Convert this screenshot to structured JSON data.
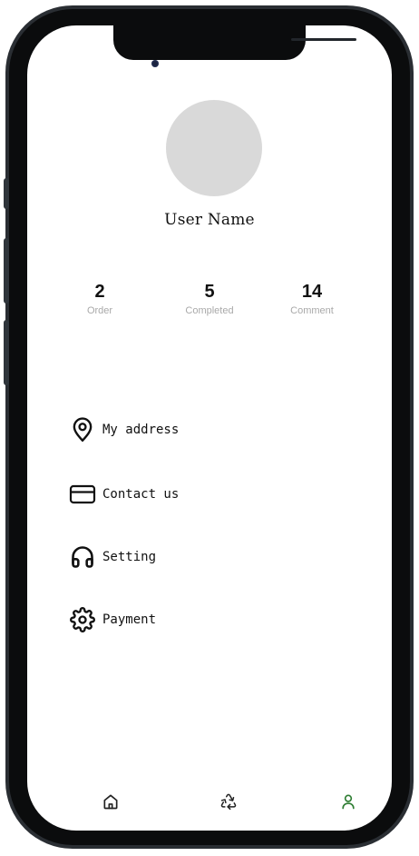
{
  "profile": {
    "user_name": "User Name",
    "avatar_icon": "avatar-placeholder"
  },
  "stats": [
    {
      "value": "2",
      "label": "Order"
    },
    {
      "value": "5",
      "label": "Completed"
    },
    {
      "value": "14",
      "label": "Comment"
    }
  ],
  "menu": {
    "items": [
      {
        "label": "My address",
        "icon": "map-pin-icon"
      },
      {
        "label": "Contact us",
        "icon": "credit-card-icon"
      },
      {
        "label": "Setting",
        "icon": "headphones-icon"
      },
      {
        "label": "Payment",
        "icon": "gear-icon"
      }
    ]
  },
  "bottom_nav": {
    "items": [
      {
        "icon": "home-icon",
        "active": false
      },
      {
        "icon": "recycle-icon",
        "active": false
      },
      {
        "icon": "user-icon",
        "active": true
      }
    ],
    "active_color": "#2e7d32",
    "inactive_color": "#222222"
  },
  "colors": {
    "avatar_bg": "#d9d9d9",
    "text_primary": "#111111",
    "text_secondary": "#a9a9a9",
    "frame": "#0b0c0d"
  }
}
